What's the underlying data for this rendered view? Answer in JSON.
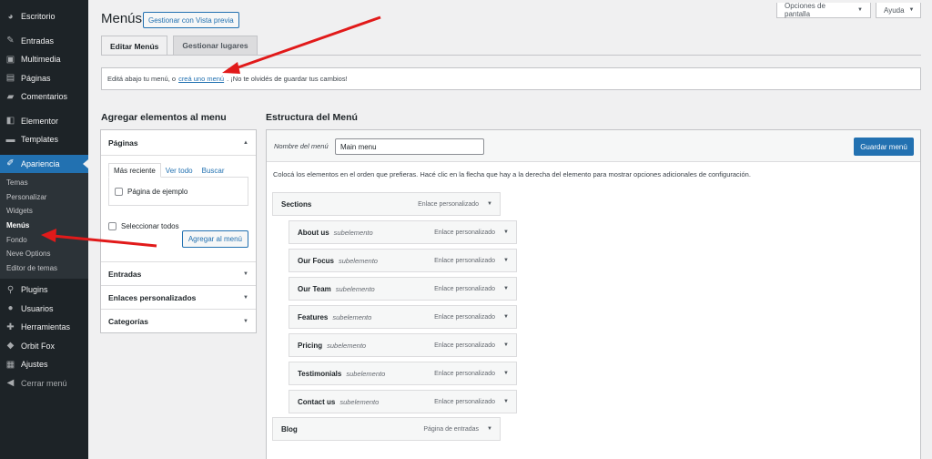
{
  "sidebar": {
    "items": [
      {
        "label": "Escritorio",
        "icon": "dashboard-icon"
      },
      {
        "label": "Entradas",
        "icon": "pin-icon"
      },
      {
        "label": "Multimedia",
        "icon": "media-icon"
      },
      {
        "label": "Páginas",
        "icon": "pages-icon"
      },
      {
        "label": "Comentarios",
        "icon": "comment-icon"
      },
      {
        "label": "Elementor",
        "icon": "elementor-icon"
      },
      {
        "label": "Templates",
        "icon": "folder-icon"
      },
      {
        "label": "Apariencia",
        "icon": "brush-icon"
      },
      {
        "label": "Plugins",
        "icon": "plugin-icon"
      },
      {
        "label": "Usuarios",
        "icon": "user-icon"
      },
      {
        "label": "Herramientas",
        "icon": "wrench-icon"
      },
      {
        "label": "Orbit Fox",
        "icon": "fox-icon"
      },
      {
        "label": "Ajustes",
        "icon": "settings-icon"
      },
      {
        "label": "Cerrar menú",
        "icon": "collapse-icon"
      }
    ],
    "submenu": [
      "Temas",
      "Personalizar",
      "Widgets",
      "Menús",
      "Fondo",
      "Neve Options",
      "Editor de temas"
    ]
  },
  "top": {
    "screen_options": "Opciones de pantalla",
    "help": "Ayuda"
  },
  "header": {
    "title": "Menús",
    "preview_button": "Gestionar con Vista previa"
  },
  "tabs": [
    "Editar Menús",
    "Gestionar lugares"
  ],
  "notice": {
    "before": "Editá abajo tu menú, o",
    "link": "creá uno menú",
    "after": ". ¡No te olvidés de guardar tus cambios!"
  },
  "left": {
    "heading": "Agregar elementos al menu",
    "pages_section": "Páginas",
    "inner_tabs": [
      "Más reciente",
      "Ver todo",
      "Buscar"
    ],
    "page_item": "Página de ejemplo",
    "select_all": "Seleccionar todos",
    "add_button": "Agregar al menú",
    "sections": [
      "Entradas",
      "Enlaces personalizados",
      "Categorías"
    ]
  },
  "right": {
    "heading": "Estructura del Menú",
    "name_label": "Nombre del menú",
    "name_value": "Main menu",
    "save_button": "Guardar menú",
    "instructions": "Colocá los elementos en el orden que prefieras. Hacé clic en la flecha que hay a la derecha del elemento para mostrar opciones adicionales de configuración.",
    "items": [
      {
        "title": "Sections",
        "sub": "",
        "type": "Enlace personalizado"
      },
      {
        "title": "About us",
        "sub": "subelemento",
        "type": "Enlace personalizado"
      },
      {
        "title": "Our Focus",
        "sub": "subelemento",
        "type": "Enlace personalizado"
      },
      {
        "title": "Our Team",
        "sub": "subelemento",
        "type": "Enlace personalizado"
      },
      {
        "title": "Features",
        "sub": "subelemento",
        "type": "Enlace personalizado"
      },
      {
        "title": "Pricing",
        "sub": "subelemento",
        "type": "Enlace personalizado"
      },
      {
        "title": "Testimonials",
        "sub": "subelemento",
        "type": "Enlace personalizado"
      },
      {
        "title": "Contact us",
        "sub": "subelemento",
        "type": "Enlace personalizado"
      },
      {
        "title": "Blog",
        "sub": "",
        "type": "Página de entradas"
      }
    ]
  },
  "colors": {
    "accent": "#2271b1",
    "sidebar": "#1d2327",
    "annotation_arrow": "#e11a1a"
  }
}
